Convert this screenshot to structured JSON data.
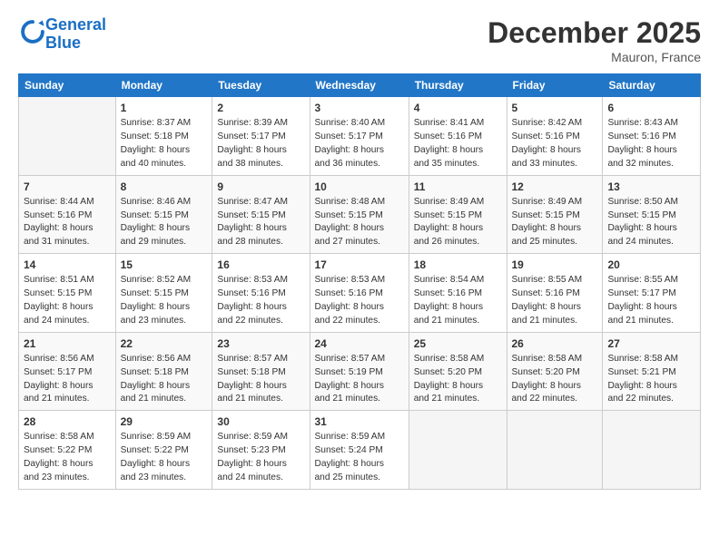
{
  "header": {
    "logo_line1": "General",
    "logo_line2": "Blue",
    "month": "December 2025",
    "location": "Mauron, France"
  },
  "days_of_week": [
    "Sunday",
    "Monday",
    "Tuesday",
    "Wednesday",
    "Thursday",
    "Friday",
    "Saturday"
  ],
  "weeks": [
    [
      {
        "day": "",
        "data": []
      },
      {
        "day": "1",
        "data": [
          "Sunrise: 8:37 AM",
          "Sunset: 5:18 PM",
          "Daylight: 8 hours",
          "and 40 minutes."
        ]
      },
      {
        "day": "2",
        "data": [
          "Sunrise: 8:39 AM",
          "Sunset: 5:17 PM",
          "Daylight: 8 hours",
          "and 38 minutes."
        ]
      },
      {
        "day": "3",
        "data": [
          "Sunrise: 8:40 AM",
          "Sunset: 5:17 PM",
          "Daylight: 8 hours",
          "and 36 minutes."
        ]
      },
      {
        "day": "4",
        "data": [
          "Sunrise: 8:41 AM",
          "Sunset: 5:16 PM",
          "Daylight: 8 hours",
          "and 35 minutes."
        ]
      },
      {
        "day": "5",
        "data": [
          "Sunrise: 8:42 AM",
          "Sunset: 5:16 PM",
          "Daylight: 8 hours",
          "and 33 minutes."
        ]
      },
      {
        "day": "6",
        "data": [
          "Sunrise: 8:43 AM",
          "Sunset: 5:16 PM",
          "Daylight: 8 hours",
          "and 32 minutes."
        ]
      }
    ],
    [
      {
        "day": "7",
        "data": [
          "Sunrise: 8:44 AM",
          "Sunset: 5:16 PM",
          "Daylight: 8 hours",
          "and 31 minutes."
        ]
      },
      {
        "day": "8",
        "data": [
          "Sunrise: 8:46 AM",
          "Sunset: 5:15 PM",
          "Daylight: 8 hours",
          "and 29 minutes."
        ]
      },
      {
        "day": "9",
        "data": [
          "Sunrise: 8:47 AM",
          "Sunset: 5:15 PM",
          "Daylight: 8 hours",
          "and 28 minutes."
        ]
      },
      {
        "day": "10",
        "data": [
          "Sunrise: 8:48 AM",
          "Sunset: 5:15 PM",
          "Daylight: 8 hours",
          "and 27 minutes."
        ]
      },
      {
        "day": "11",
        "data": [
          "Sunrise: 8:49 AM",
          "Sunset: 5:15 PM",
          "Daylight: 8 hours",
          "and 26 minutes."
        ]
      },
      {
        "day": "12",
        "data": [
          "Sunrise: 8:49 AM",
          "Sunset: 5:15 PM",
          "Daylight: 8 hours",
          "and 25 minutes."
        ]
      },
      {
        "day": "13",
        "data": [
          "Sunrise: 8:50 AM",
          "Sunset: 5:15 PM",
          "Daylight: 8 hours",
          "and 24 minutes."
        ]
      }
    ],
    [
      {
        "day": "14",
        "data": [
          "Sunrise: 8:51 AM",
          "Sunset: 5:15 PM",
          "Daylight: 8 hours",
          "and 24 minutes."
        ]
      },
      {
        "day": "15",
        "data": [
          "Sunrise: 8:52 AM",
          "Sunset: 5:15 PM",
          "Daylight: 8 hours",
          "and 23 minutes."
        ]
      },
      {
        "day": "16",
        "data": [
          "Sunrise: 8:53 AM",
          "Sunset: 5:16 PM",
          "Daylight: 8 hours",
          "and 22 minutes."
        ]
      },
      {
        "day": "17",
        "data": [
          "Sunrise: 8:53 AM",
          "Sunset: 5:16 PM",
          "Daylight: 8 hours",
          "and 22 minutes."
        ]
      },
      {
        "day": "18",
        "data": [
          "Sunrise: 8:54 AM",
          "Sunset: 5:16 PM",
          "Daylight: 8 hours",
          "and 21 minutes."
        ]
      },
      {
        "day": "19",
        "data": [
          "Sunrise: 8:55 AM",
          "Sunset: 5:16 PM",
          "Daylight: 8 hours",
          "and 21 minutes."
        ]
      },
      {
        "day": "20",
        "data": [
          "Sunrise: 8:55 AM",
          "Sunset: 5:17 PM",
          "Daylight: 8 hours",
          "and 21 minutes."
        ]
      }
    ],
    [
      {
        "day": "21",
        "data": [
          "Sunrise: 8:56 AM",
          "Sunset: 5:17 PM",
          "Daylight: 8 hours",
          "and 21 minutes."
        ]
      },
      {
        "day": "22",
        "data": [
          "Sunrise: 8:56 AM",
          "Sunset: 5:18 PM",
          "Daylight: 8 hours",
          "and 21 minutes."
        ]
      },
      {
        "day": "23",
        "data": [
          "Sunrise: 8:57 AM",
          "Sunset: 5:18 PM",
          "Daylight: 8 hours",
          "and 21 minutes."
        ]
      },
      {
        "day": "24",
        "data": [
          "Sunrise: 8:57 AM",
          "Sunset: 5:19 PM",
          "Daylight: 8 hours",
          "and 21 minutes."
        ]
      },
      {
        "day": "25",
        "data": [
          "Sunrise: 8:58 AM",
          "Sunset: 5:20 PM",
          "Daylight: 8 hours",
          "and 21 minutes."
        ]
      },
      {
        "day": "26",
        "data": [
          "Sunrise: 8:58 AM",
          "Sunset: 5:20 PM",
          "Daylight: 8 hours",
          "and 22 minutes."
        ]
      },
      {
        "day": "27",
        "data": [
          "Sunrise: 8:58 AM",
          "Sunset: 5:21 PM",
          "Daylight: 8 hours",
          "and 22 minutes."
        ]
      }
    ],
    [
      {
        "day": "28",
        "data": [
          "Sunrise: 8:58 AM",
          "Sunset: 5:22 PM",
          "Daylight: 8 hours",
          "and 23 minutes."
        ]
      },
      {
        "day": "29",
        "data": [
          "Sunrise: 8:59 AM",
          "Sunset: 5:22 PM",
          "Daylight: 8 hours",
          "and 23 minutes."
        ]
      },
      {
        "day": "30",
        "data": [
          "Sunrise: 8:59 AM",
          "Sunset: 5:23 PM",
          "Daylight: 8 hours",
          "and 24 minutes."
        ]
      },
      {
        "day": "31",
        "data": [
          "Sunrise: 8:59 AM",
          "Sunset: 5:24 PM",
          "Daylight: 8 hours",
          "and 25 minutes."
        ]
      },
      {
        "day": "",
        "data": []
      },
      {
        "day": "",
        "data": []
      },
      {
        "day": "",
        "data": []
      }
    ]
  ]
}
